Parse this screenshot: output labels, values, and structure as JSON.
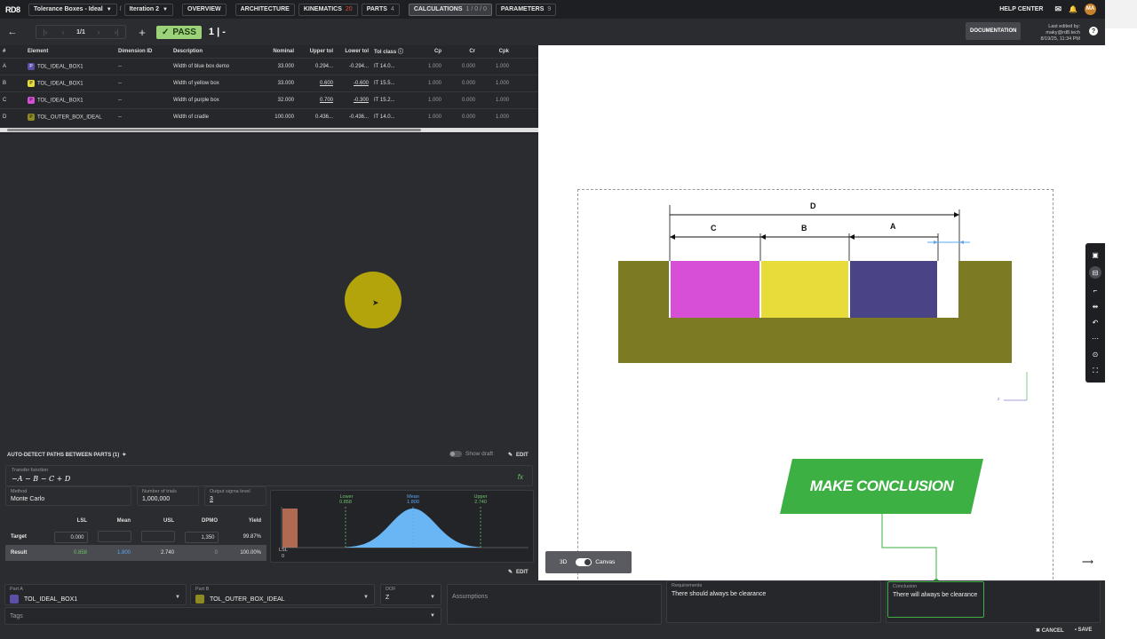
{
  "app": {
    "logo": "RD8",
    "project": "Tolerance Boxes - Ideal",
    "iteration": "Iteration 2",
    "tabs": [
      {
        "label": "OVERVIEW",
        "count": ""
      },
      {
        "label": "ARCHITECTURE",
        "count": ""
      },
      {
        "label": "KINEMATICS",
        "count": "20"
      },
      {
        "label": "PARTS",
        "count": "4"
      },
      {
        "label": "CALCULATIONS",
        "count": "1 / 0 / 0"
      },
      {
        "label": "PARAMETERS",
        "count": "9"
      }
    ],
    "help_center": "HELP CENTER",
    "avatar": "MA"
  },
  "toolbar": {
    "page": "1/1",
    "pass_label": "PASS",
    "iteration_counter": "1 | -",
    "documentation": "DOCUMENTATION",
    "last_edited_line1": "Last edited by: maky@rd8.tech",
    "last_edited_line2": "8/19/25, 11:34 PM"
  },
  "table": {
    "headers": [
      "#",
      "Element",
      "Dimension ID",
      "Description",
      "Nominal",
      "Upper tol",
      "Lower tol",
      "Tol class",
      "Cp",
      "Cr",
      "Cpk"
    ],
    "rows": [
      {
        "id": "A",
        "element": "TOL_IDEAL_BOX1",
        "swatch": "#5b4fa8",
        "tag": "P",
        "dim": "--",
        "desc": "Width of blue box demo",
        "nominal": "33.000",
        "upper": "0.294...",
        "lower": "-0.294...",
        "tolclass": "IT 14.0...",
        "cp": "1.000",
        "cr": "0.000",
        "cpk": "1.000"
      },
      {
        "id": "B",
        "element": "TOL_IDEAL_BOX1",
        "swatch": "#e8dc3a",
        "tag": "P",
        "dim": "--",
        "desc": "Width of yellow box",
        "nominal": "33.000",
        "upper": "0.600",
        "lower": "-0.600",
        "tolclass": "IT 15.5...",
        "cp": "1.000",
        "cr": "0.000",
        "cpk": "1.000"
      },
      {
        "id": "C",
        "element": "TOL_IDEAL_BOX1",
        "swatch": "#d64fd6",
        "tag": "P",
        "dim": "--",
        "desc": "Width of purple box",
        "nominal": "32.000",
        "upper": "0.700",
        "lower": "-0.300",
        "tolclass": "IT 15.2...",
        "cp": "1.000",
        "cr": "0.000",
        "cpk": "1.000"
      },
      {
        "id": "D",
        "element": "TOL_OUTER_BOX_IDEAL",
        "swatch": "#8e8a22",
        "tag": "P",
        "dim": "--",
        "desc": "Width of cradle",
        "nominal": "100.000",
        "upper": "0.436...",
        "lower": "-0.436...",
        "tolclass": "IT 14.0...",
        "cp": "1.000",
        "cr": "0.000",
        "cpk": "1.000"
      }
    ]
  },
  "analysis": {
    "auto_detect": "AUTO-DETECT PATHS BETWEEN PARTS (1)",
    "show_draft": "Show draft",
    "edit": "EDIT",
    "transfer_label": "Transfer function",
    "transfer_value": "−A − B − C + D",
    "method_label": "Method",
    "method_value": "Monte Carlo",
    "trials_label": "Number of trials",
    "trials_value": "1,000,000",
    "sigma_label": "Output sigma level",
    "sigma_value": "3",
    "stats_headers": [
      "LSL",
      "Mean",
      "USL",
      "DPMO",
      "Yield"
    ],
    "target_label": "Target",
    "target": [
      "0.000",
      "",
      "",
      "1,350",
      "99.87%"
    ],
    "result_label": "Result",
    "result": [
      "0.858",
      "1.800",
      "2.740",
      "0",
      "100.00%"
    ]
  },
  "histogram": {
    "lower_label": "Lower",
    "lower_value": "0.858",
    "mean_label": "Mean",
    "mean_value": "1.800",
    "upper_label": "Upper",
    "upper_value": "2.740",
    "lsl_label": "LSL",
    "lsl_value": "0"
  },
  "bottom": {
    "partA_label": "Part A",
    "partA_value": "TOL_IDEAL_BOX1",
    "partA_color": "#5b4fa8",
    "partB_label": "Part B",
    "partB_value": "TOL_OUTER_BOX_IDEAL",
    "partB_color": "#8e8a22",
    "dof_label": "DOF",
    "dof_value": "Z",
    "assumptions_placeholder": "Assumptions",
    "requirements_label": "Requirements",
    "requirements_value": "There should always be clearance",
    "conclusion_label": "Conclusion",
    "conclusion_value": "There will always be clearance",
    "tags_placeholder": "Tags",
    "cancel": "CANCEL",
    "save": "SAVE"
  },
  "viewer": {
    "dim_labels": [
      "D",
      "C",
      "B",
      "A"
    ],
    "mode_3d": "3D",
    "mode_canvas": "Canvas",
    "callout": "MAKE CONCLUSION",
    "colors": {
      "cradle": "#7c7a22",
      "purple": "#d64fd6",
      "yellow": "#e8dc3a",
      "blue": "#4a4386",
      "callout": "#3cb043"
    }
  }
}
